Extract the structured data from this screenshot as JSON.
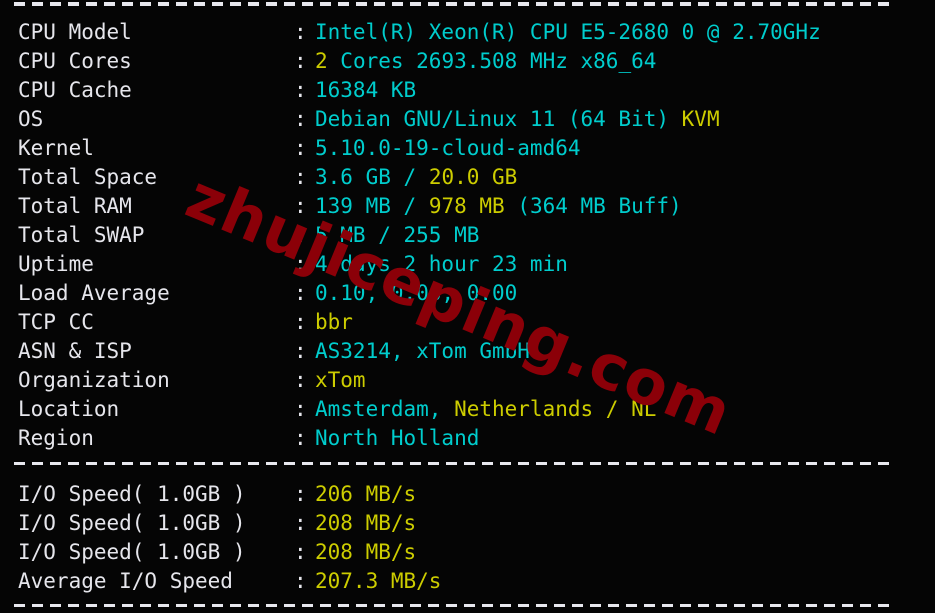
{
  "terminal": {
    "background": "#050505",
    "colors": {
      "label": "#e6e6ec",
      "cyan": "#00cdcd",
      "yellow": "#cdcd00",
      "watermark": "#8b0008"
    },
    "separator_char": "-",
    "colon": ":"
  },
  "watermark": {
    "text": "zhujiceping.com"
  },
  "system_info": [
    {
      "label": "CPU Model",
      "segments": [
        {
          "text": "Intel(R) Xeon(R) CPU E5-2680 0 @ 2.70GHz",
          "color": "cyan"
        }
      ]
    },
    {
      "label": "CPU Cores",
      "segments": [
        {
          "text": "2 ",
          "color": "yellow"
        },
        {
          "text": "Cores 2693.508 MHz x86_64",
          "color": "cyan"
        }
      ]
    },
    {
      "label": "CPU Cache",
      "segments": [
        {
          "text": "16384 KB",
          "color": "cyan"
        }
      ]
    },
    {
      "label": "OS",
      "segments": [
        {
          "text": "Debian GNU/Linux 11 (64 Bit) ",
          "color": "cyan"
        },
        {
          "text": "KVM",
          "color": "yellow"
        }
      ]
    },
    {
      "label": "Kernel",
      "segments": [
        {
          "text": "5.10.0-19-cloud-amd64",
          "color": "cyan"
        }
      ]
    },
    {
      "label": "Total Space",
      "segments": [
        {
          "text": "3.6 GB ",
          "color": "cyan"
        },
        {
          "text": "/ ",
          "color": "cyan"
        },
        {
          "text": "20.0 GB",
          "color": "yellow"
        }
      ]
    },
    {
      "label": "Total RAM",
      "segments": [
        {
          "text": "139 MB ",
          "color": "cyan"
        },
        {
          "text": "/ ",
          "color": "cyan"
        },
        {
          "text": "978 MB ",
          "color": "yellow"
        },
        {
          "text": "(364 MB Buff)",
          "color": "cyan"
        }
      ]
    },
    {
      "label": "Total SWAP",
      "segments": [
        {
          "text": "5 MB / 255 MB",
          "color": "cyan"
        }
      ]
    },
    {
      "label": "Uptime",
      "segments": [
        {
          "text": "4 days 2 hour 23 min",
          "color": "cyan"
        }
      ]
    },
    {
      "label": "Load Average",
      "segments": [
        {
          "text": "0.10, 0.06, 0.00",
          "color": "cyan"
        }
      ]
    },
    {
      "label": "TCP CC",
      "segments": [
        {
          "text": "bbr",
          "color": "yellow"
        }
      ]
    },
    {
      "label": "ASN & ISP",
      "segments": [
        {
          "text": "AS3214, xTom GmbH",
          "color": "cyan"
        }
      ]
    },
    {
      "label": "Organization",
      "segments": [
        {
          "text": "xTom",
          "color": "yellow"
        }
      ]
    },
    {
      "label": "Location",
      "segments": [
        {
          "text": "Amsterdam, ",
          "color": "cyan"
        },
        {
          "text": "Netherlands / NL",
          "color": "yellow"
        }
      ]
    },
    {
      "label": "Region",
      "segments": [
        {
          "text": "North Holland",
          "color": "cyan"
        }
      ]
    }
  ],
  "io_results": [
    {
      "label": "I/O Speed( 1.0GB )",
      "segments": [
        {
          "text": "206 MB/s",
          "color": "yellow"
        }
      ]
    },
    {
      "label": "I/O Speed( 1.0GB )",
      "segments": [
        {
          "text": "208 MB/s",
          "color": "yellow"
        }
      ]
    },
    {
      "label": "I/O Speed( 1.0GB )",
      "segments": [
        {
          "text": "208 MB/s",
          "color": "yellow"
        }
      ]
    },
    {
      "label": "Average I/O Speed",
      "segments": [
        {
          "text": "207.3 MB/s",
          "color": "yellow"
        }
      ]
    }
  ]
}
